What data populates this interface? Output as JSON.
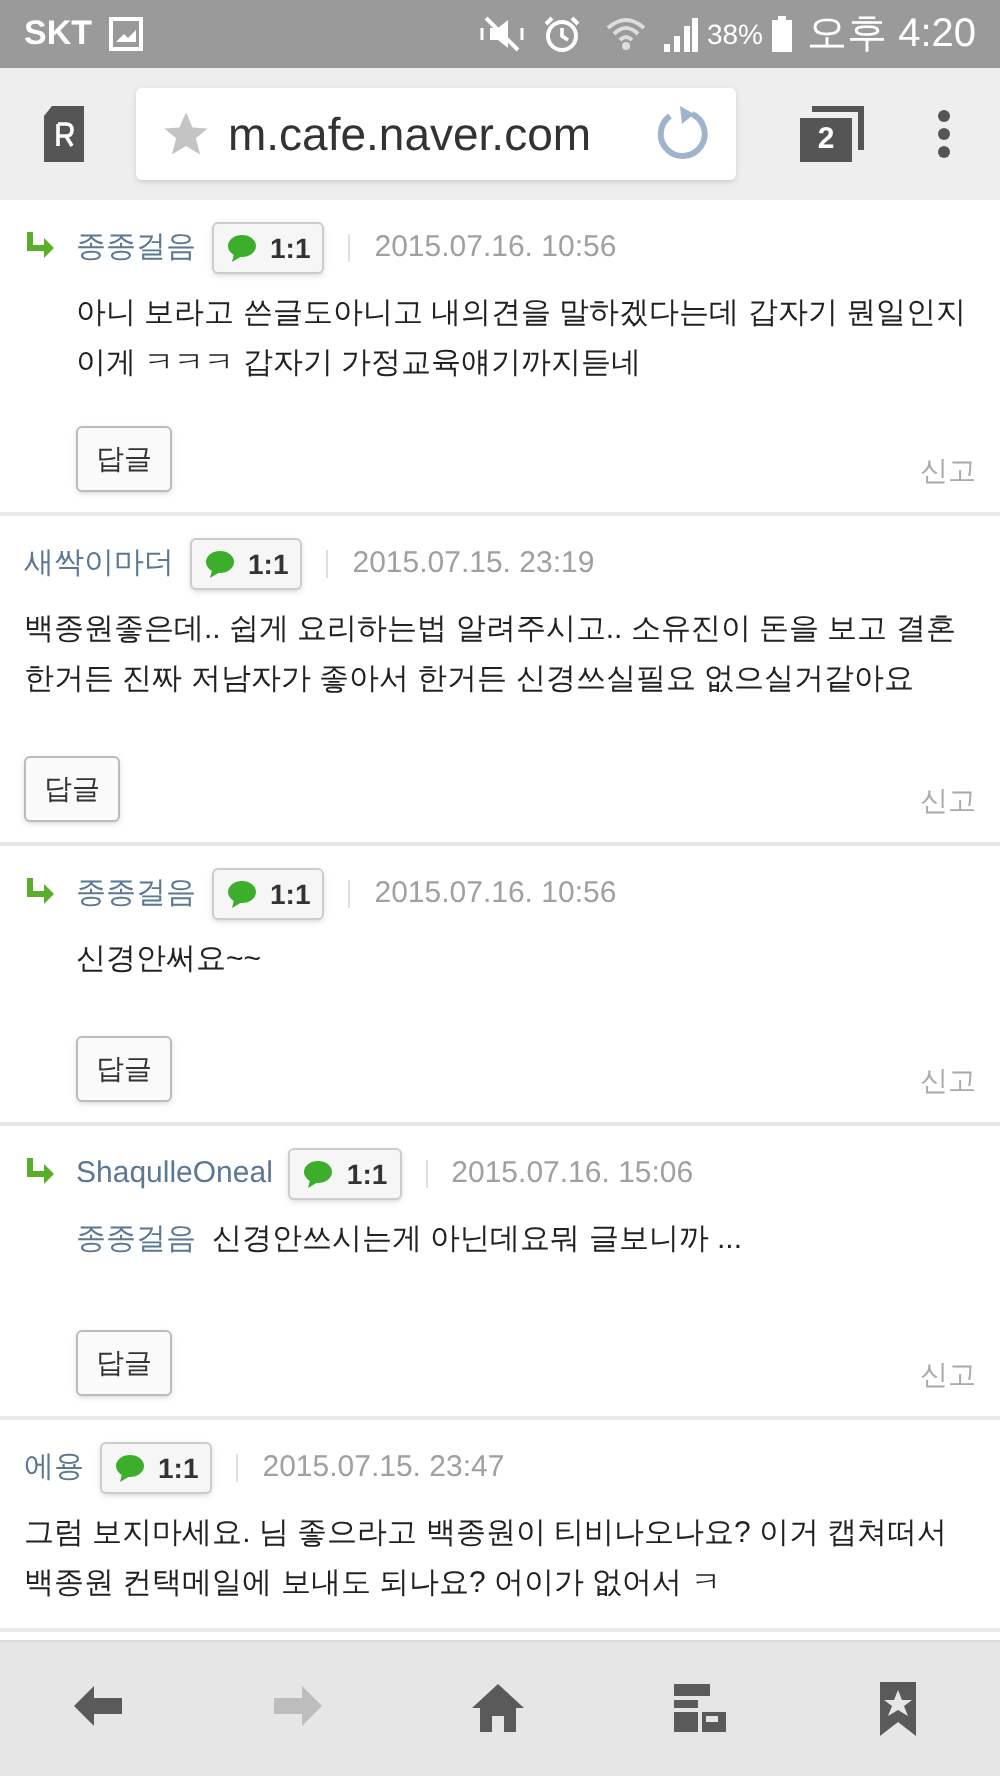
{
  "status_bar": {
    "carrier": "SKT",
    "battery": "38%",
    "time": "오후 4:20"
  },
  "browser": {
    "url": "m.cafe.naver.com",
    "tab_count": "2"
  },
  "comments": [
    {
      "is_reply": true,
      "author": "종종걸음",
      "chat_badge": "1:1",
      "date": "2015.07.16. 10:56",
      "text": "아니 보라고 쓴글도아니고 내의견을 말하겠다는데 갑자기 뭔일인지 이게 ㅋㅋㅋ 갑자기 가정교육얘기까지듣네",
      "reply_button": "답글",
      "report": "신고"
    },
    {
      "is_reply": false,
      "author": "새싹이마더",
      "chat_badge": "1:1",
      "date": "2015.07.15. 23:19",
      "text": "백종원좋은데.. 쉽게 요리하는법 알려주시고.. 소유진이 돈을 보고 결혼한거든 진짜 저남자가 좋아서 한거든 신경쓰실필요 없으실거같아요",
      "reply_button": "답글",
      "report": "신고"
    },
    {
      "is_reply": true,
      "author": "종종걸음",
      "chat_badge": "1:1",
      "date": "2015.07.16. 10:56",
      "text": "신경안써요~~",
      "reply_button": "답글",
      "report": "신고"
    },
    {
      "is_reply": true,
      "author": "ShaqulleOneal",
      "chat_badge": "1:1",
      "date": "2015.07.16. 15:06",
      "mention": "종종걸음",
      "text": "신경안쓰시는게 아닌데요뭐 글보니까 ...",
      "reply_button": "답글",
      "report": "신고"
    },
    {
      "is_reply": false,
      "author": "에용",
      "chat_badge": "1:1",
      "date": "2015.07.15. 23:47",
      "text": "그럼 보지마세요. 님 좋으라고 백종원이 티비나오나요? 이거 캡쳐떠서 백종원 컨택메일에 보내도 되나요? 어이가 없어서 ㅋ"
    }
  ],
  "bottom_nav": [
    {
      "kind": "back",
      "disabled": false
    },
    {
      "kind": "forward",
      "disabled": true
    },
    {
      "kind": "home",
      "disabled": false
    },
    {
      "kind": "reader",
      "disabled": false
    },
    {
      "kind": "bookmarks",
      "disabled": false
    }
  ]
}
